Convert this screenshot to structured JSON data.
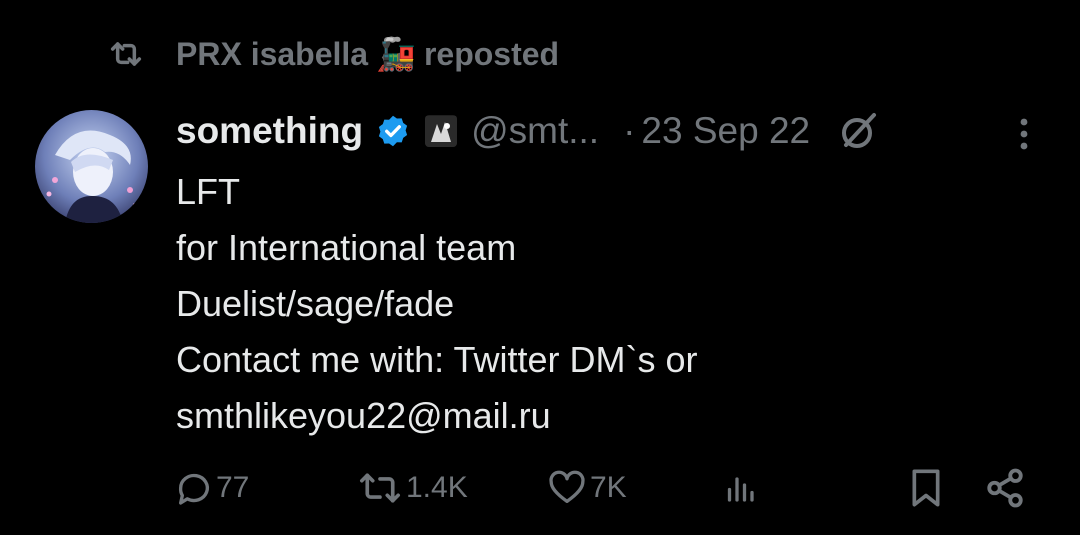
{
  "repost": {
    "user": "PRX isabella",
    "emoji": "🚂",
    "label": "reposted"
  },
  "tweet": {
    "display_name": "something",
    "handle": "@smt...",
    "separator": "·",
    "date": "23 Sep 22",
    "lines": [
      "LFT",
      "for International team",
      "Duelist/sage/fade",
      "Contact me with: Twitter DM`s or",
      "smthlikeyou22@mail.ru"
    ]
  },
  "actions": {
    "replies": "77",
    "reposts": "1.4K",
    "likes": "7K"
  },
  "colors": {
    "background": "#000000",
    "text": "#e7e9ea",
    "muted": "#71767b",
    "verified": "#1d9bf0"
  }
}
